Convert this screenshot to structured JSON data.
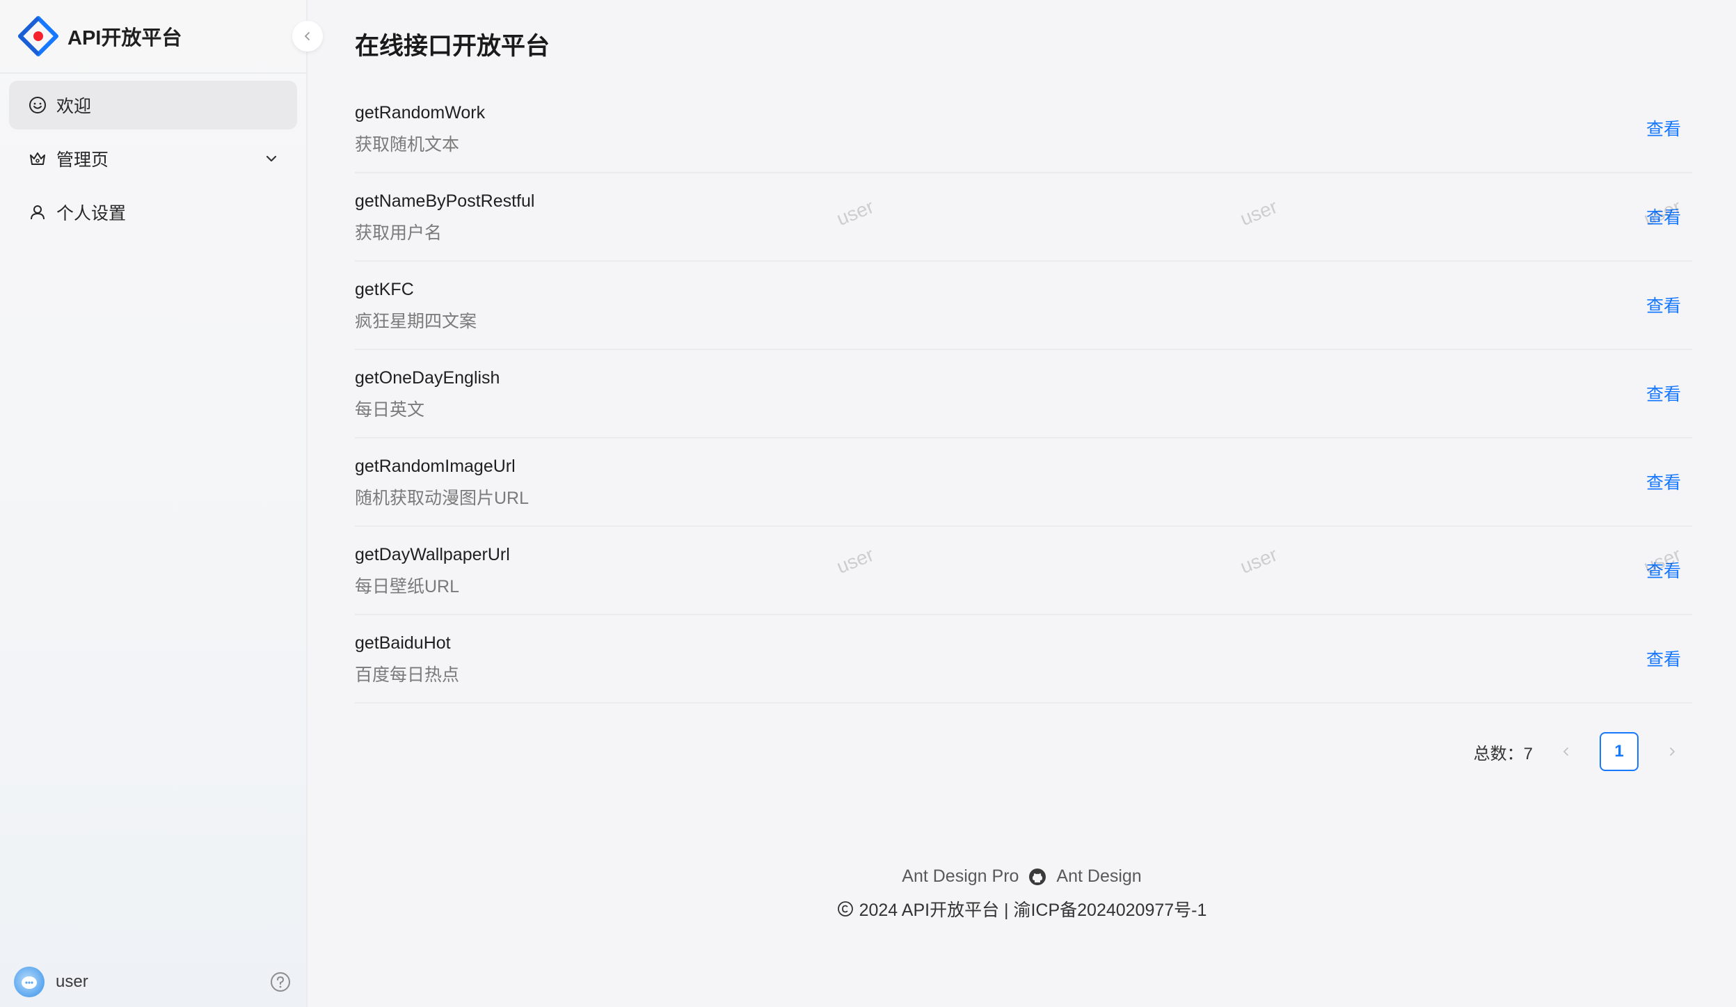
{
  "brand": {
    "title": "API开放平台"
  },
  "sidebar": {
    "items": [
      {
        "label": "欢迎",
        "icon": "smile-icon",
        "active": true
      },
      {
        "label": "管理页",
        "icon": "crown-icon",
        "has_children": true
      },
      {
        "label": "个人设置",
        "icon": "user-icon"
      }
    ],
    "user": {
      "name": "user"
    }
  },
  "main": {
    "title": "在线接口开放平台",
    "action_label": "查看",
    "apis": [
      {
        "name": "getRandomWork",
        "desc": "获取随机文本"
      },
      {
        "name": "getNameByPostRestful",
        "desc": "获取用户名"
      },
      {
        "name": "getKFC",
        "desc": "疯狂星期四文案"
      },
      {
        "name": "getOneDayEnglish",
        "desc": "每日英文"
      },
      {
        "name": "getRandomImageUrl",
        "desc": "随机获取动漫图片URL"
      },
      {
        "name": "getDayWallpaperUrl",
        "desc": "每日壁纸URL"
      },
      {
        "name": "getBaiduHot",
        "desc": "百度每日热点"
      }
    ],
    "pagination": {
      "total_label": "总数：7",
      "current_page": "1"
    }
  },
  "footer": {
    "link1": "Ant Design Pro",
    "link2": "Ant Design",
    "copyright": "2024 API开放平台 | 渝ICP备2024020977号-1"
  },
  "watermark_text": "user",
  "colors": {
    "primary": "#1677ff",
    "sidebar_bg": "#f6f6f8"
  }
}
